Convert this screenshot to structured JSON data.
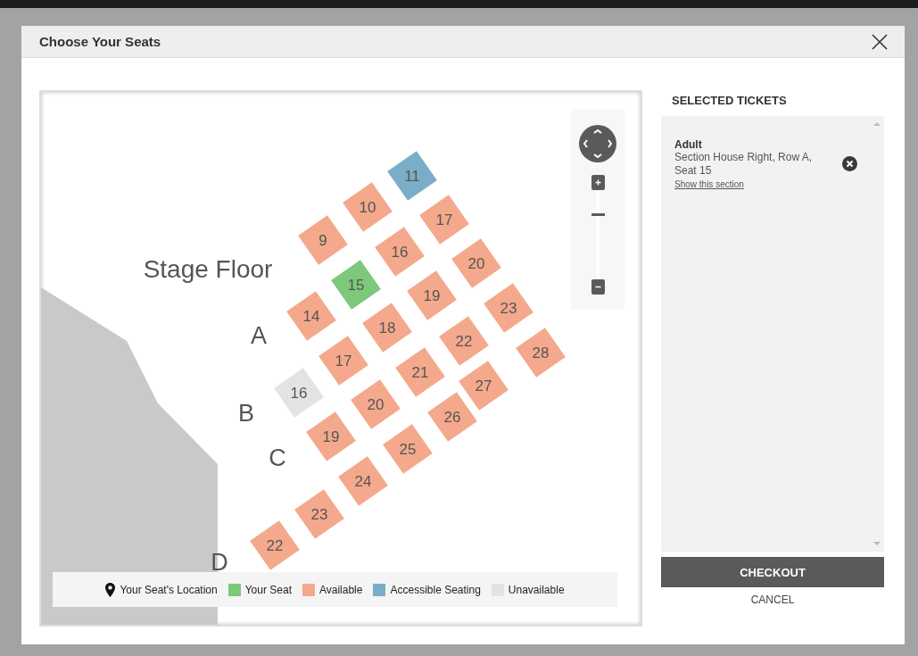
{
  "dialog": {
    "title": "Choose Your Seats"
  },
  "map": {
    "stage_label": "Stage Floor",
    "row_labels": [
      "A",
      "B",
      "C",
      "D"
    ],
    "zoom": {
      "level": 0.71
    },
    "seats": [
      {
        "label": "11",
        "kind": "accessible"
      },
      {
        "label": "10",
        "kind": "available"
      },
      {
        "label": "17",
        "kind": "available"
      },
      {
        "label": "9",
        "kind": "available"
      },
      {
        "label": "16",
        "kind": "available"
      },
      {
        "label": "20",
        "kind": "available"
      },
      {
        "label": "15",
        "kind": "yours"
      },
      {
        "label": "19",
        "kind": "available"
      },
      {
        "label": "14",
        "kind": "available"
      },
      {
        "label": "23",
        "kind": "available"
      },
      {
        "label": "18",
        "kind": "available"
      },
      {
        "label": "22",
        "kind": "available"
      },
      {
        "label": "28",
        "kind": "available"
      },
      {
        "label": "17",
        "kind": "available"
      },
      {
        "label": "21",
        "kind": "available"
      },
      {
        "label": "27",
        "kind": "available"
      },
      {
        "label": "16",
        "kind": "unavailable"
      },
      {
        "label": "20",
        "kind": "available"
      },
      {
        "label": "26",
        "kind": "available"
      },
      {
        "label": "19",
        "kind": "available"
      },
      {
        "label": "25",
        "kind": "available"
      },
      {
        "label": "24",
        "kind": "available"
      },
      {
        "label": "23",
        "kind": "available"
      },
      {
        "label": "22",
        "kind": "available"
      }
    ],
    "legend": [
      {
        "label": "Your Seat's Location",
        "kind": "location"
      },
      {
        "label": "Your Seat",
        "kind": "yours"
      },
      {
        "label": "Available",
        "kind": "available"
      },
      {
        "label": "Accessible Seating",
        "kind": "accessible"
      },
      {
        "label": "Unavailable",
        "kind": "unavailable"
      }
    ]
  },
  "selected_tickets": {
    "heading": "SELECTED TICKETS",
    "tickets": [
      {
        "type": "Adult",
        "description": "Section House Right, Row A, Seat 15",
        "link": "Show this section"
      }
    ]
  },
  "buttons": {
    "checkout": "CHECKOUT",
    "cancel": "CANCEL"
  }
}
